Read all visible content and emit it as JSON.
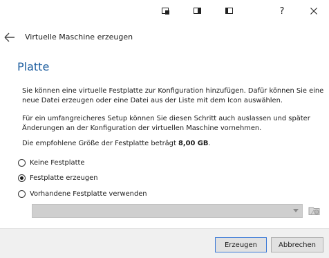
{
  "window": {
    "help_label": "?"
  },
  "header": {
    "title": "Virtuelle Maschine erzeugen"
  },
  "page": {
    "title": "Platte",
    "paragraph1_line1": "Sie können eine virtuelle Festplatte zur Konfiguration hinzufügen. Dafür können Sie eine",
    "paragraph1_line2": "neue Datei erzeugen oder eine Datei aus der Liste mit dem Icon auswählen.",
    "paragraph2_line1": "Für ein umfangreicheres Setup können Sie diesen Schritt auch auslassen und später",
    "paragraph2_line2": "Änderungen an der Konfiguration der virtuellen Maschine vornehmen.",
    "size_prefix": "Die empfohlene Größe der Festplatte beträgt ",
    "size_value": "8,00 GB",
    "size_suffix": "."
  },
  "options": [
    {
      "label": "Keine Festplatte",
      "selected": false
    },
    {
      "label": "Festplatte erzeugen",
      "selected": true
    },
    {
      "label": "Vorhandene Festplatte verwenden",
      "selected": false
    }
  ],
  "existing_disk": {
    "value": ""
  },
  "buttons": {
    "create": "Erzeugen",
    "cancel": "Abbrechen"
  }
}
